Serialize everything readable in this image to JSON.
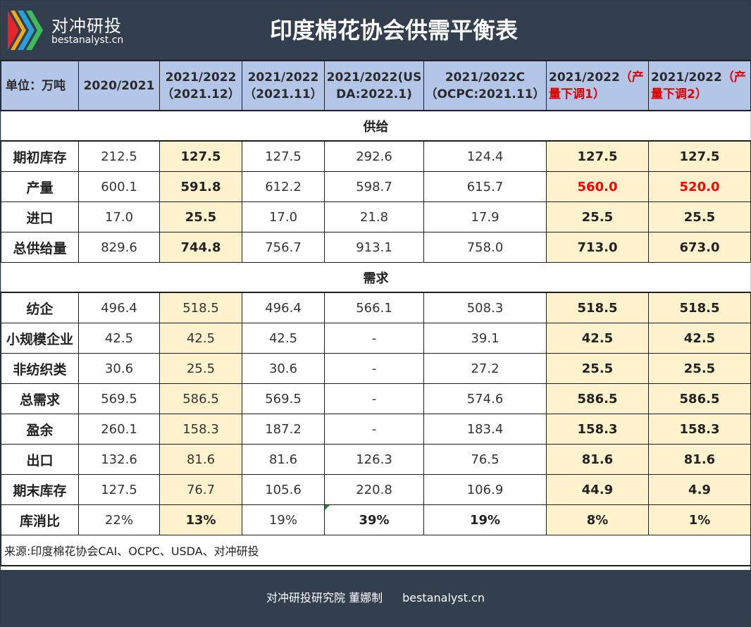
{
  "header": {
    "logo_cn": "对冲研投",
    "logo_en": "bestanalyst.cn",
    "title": "印度棉花协会供需平衡表"
  },
  "columns": {
    "unit": "单位：万吨",
    "c1": [
      "2020/2021"
    ],
    "c2": [
      "2021/2022",
      "（2021.12）"
    ],
    "c3": [
      "2021/2022",
      "（2021.11）"
    ],
    "c4": [
      "2021/2022(US",
      "DA:2022.1)"
    ],
    "c5": [
      "2021/2022C",
      "（OCPC:2021.11）"
    ],
    "c6": {
      "a": "2021/2022",
      "b": "（产",
      "c": "量下调1）"
    },
    "c7": {
      "a": "2021/2022",
      "b": "（产",
      "c": "量下调2）"
    }
  },
  "sections": {
    "supply": "供给",
    "demand": "需求"
  },
  "rows": {
    "r1": {
      "label": "期初库存",
      "v": [
        "212.5",
        "127.5",
        "127.5",
        "292.6",
        "124.4",
        "127.5",
        "127.5"
      ]
    },
    "r2": {
      "label": "产量",
      "v": [
        "600.1",
        "591.8",
        "612.2",
        "598.7",
        "615.7",
        "560.0",
        "520.0"
      ]
    },
    "r3": {
      "label": "进口",
      "v": [
        "17.0",
        "25.5",
        "17.0",
        "21.8",
        "17.9",
        "25.5",
        "25.5"
      ]
    },
    "r4": {
      "label": "总供给量",
      "v": [
        "829.6",
        "744.8",
        "756.7",
        "913.1",
        "758.0",
        "713.0",
        "673.0"
      ]
    },
    "r5": {
      "label": "纺企",
      "v": [
        "496.4",
        "518.5",
        "496.4",
        "566.1",
        "508.3",
        "518.5",
        "518.5"
      ]
    },
    "r6": {
      "label": "小规模企业",
      "v": [
        "42.5",
        "42.5",
        "42.5",
        "-",
        "39.1",
        "42.5",
        "42.5"
      ]
    },
    "r7": {
      "label": "非纺织类",
      "v": [
        "30.6",
        "25.5",
        "30.6",
        "-",
        "27.2",
        "25.5",
        "25.5"
      ]
    },
    "r8": {
      "label": "总需求",
      "v": [
        "569.5",
        "586.5",
        "569.5",
        "-",
        "574.6",
        "586.5",
        "586.5"
      ]
    },
    "r9": {
      "label": "盈余",
      "v": [
        "260.1",
        "158.3",
        "187.2",
        "-",
        "183.4",
        "158.3",
        "158.3"
      ]
    },
    "r10": {
      "label": "出口",
      "v": [
        "132.6",
        "81.6",
        "81.6",
        "126.3",
        "76.5",
        "81.6",
        "81.6"
      ]
    },
    "r11": {
      "label": "期末库存",
      "v": [
        "127.5",
        "76.7",
        "105.6",
        "220.8",
        "106.9",
        "44.9",
        "4.9"
      ]
    },
    "r12": {
      "label": "库消比",
      "v": [
        "22%",
        "13%",
        "19%",
        "39%",
        "19%",
        "8%",
        "1%"
      ]
    }
  },
  "source": "来源:印度棉花协会CAI、OCPC、USDA、对冲研投",
  "footer": {
    "credit": "对冲研投研究院 董娜制",
    "site": "bestanalyst.cn"
  },
  "colors": {
    "header_bg": "#333f4f",
    "column_header_bg": "#b4c6e7",
    "highlight_bg": "#fff2cc",
    "emphasis_red": "#ff0000"
  }
}
